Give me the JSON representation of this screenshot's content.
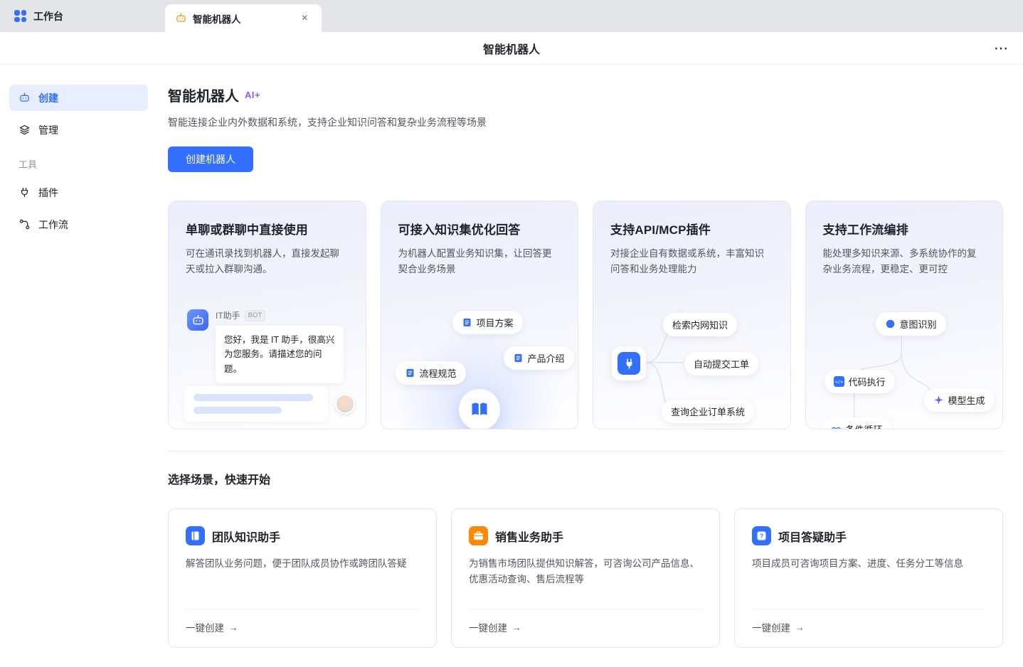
{
  "window": {
    "workbench_tab": "工作台",
    "active_tab": "智能机器人",
    "header_title": "智能机器人"
  },
  "icons": {
    "close": "×",
    "more": "⋯",
    "arrow": "→"
  },
  "sidebar": {
    "create": "创建",
    "manage": "管理",
    "tools_section": "工具",
    "plugins": "插件",
    "workflow": "工作流"
  },
  "main": {
    "title": "智能机器人",
    "badge": "AI+",
    "subtitle": "智能连接企业内外数据和系统，支持企业知识问答和复杂业务流程等场景",
    "create_button": "创建机器人",
    "feature_cards": [
      {
        "title": "单聊或群聊中直接使用",
        "desc": "可在通讯录找到机器人，直接发起聊天或拉入群聊沟通。",
        "chat": {
          "bot_name": "IT助手",
          "bot_badge": "BOT",
          "message": "您好，我是 IT 助手，很高兴为您服务。请描述您的问题。"
        }
      },
      {
        "title": "可接入知识集优化回答",
        "desc": "为机器人配置业务知识集，让回答更契合业务场景",
        "tags": [
          "项目方案",
          "产品介绍",
          "流程规范"
        ]
      },
      {
        "title": "支持API/MCP插件",
        "desc": "对接企业自有数据或系统，丰富知识问答和业务处理能力",
        "tags": [
          "检索内网知识",
          "自动提交工单",
          "查询企业订单系统"
        ]
      },
      {
        "title": "支持工作流编排",
        "desc": "能处理多知识来源、多系统协作的复杂业务流程，更稳定、更可控",
        "tags": [
          "意图识别",
          "代码执行",
          "模型生成",
          "条件循环"
        ]
      }
    ],
    "scenario_title": "选择场景，快速开始",
    "scenario_cards": [
      {
        "title": "团队知识助手",
        "desc": "解答团队业务问题，便于团队成员协作或跨团队答疑",
        "action": "一键创建"
      },
      {
        "title": "销售业务助手",
        "desc": "为销售市场团队提供知识解答，可咨询公司产品信息、优惠活动查询、售后流程等",
        "action": "一键创建"
      },
      {
        "title": "项目答疑助手",
        "desc": "项目成员可咨询项目方案、进度、任务分工等信息",
        "action": "一键创建"
      }
    ]
  },
  "colors": {
    "accent": "#3370ff",
    "badge": "#8a5cff",
    "scenario_icon_2": "#ff8800"
  }
}
